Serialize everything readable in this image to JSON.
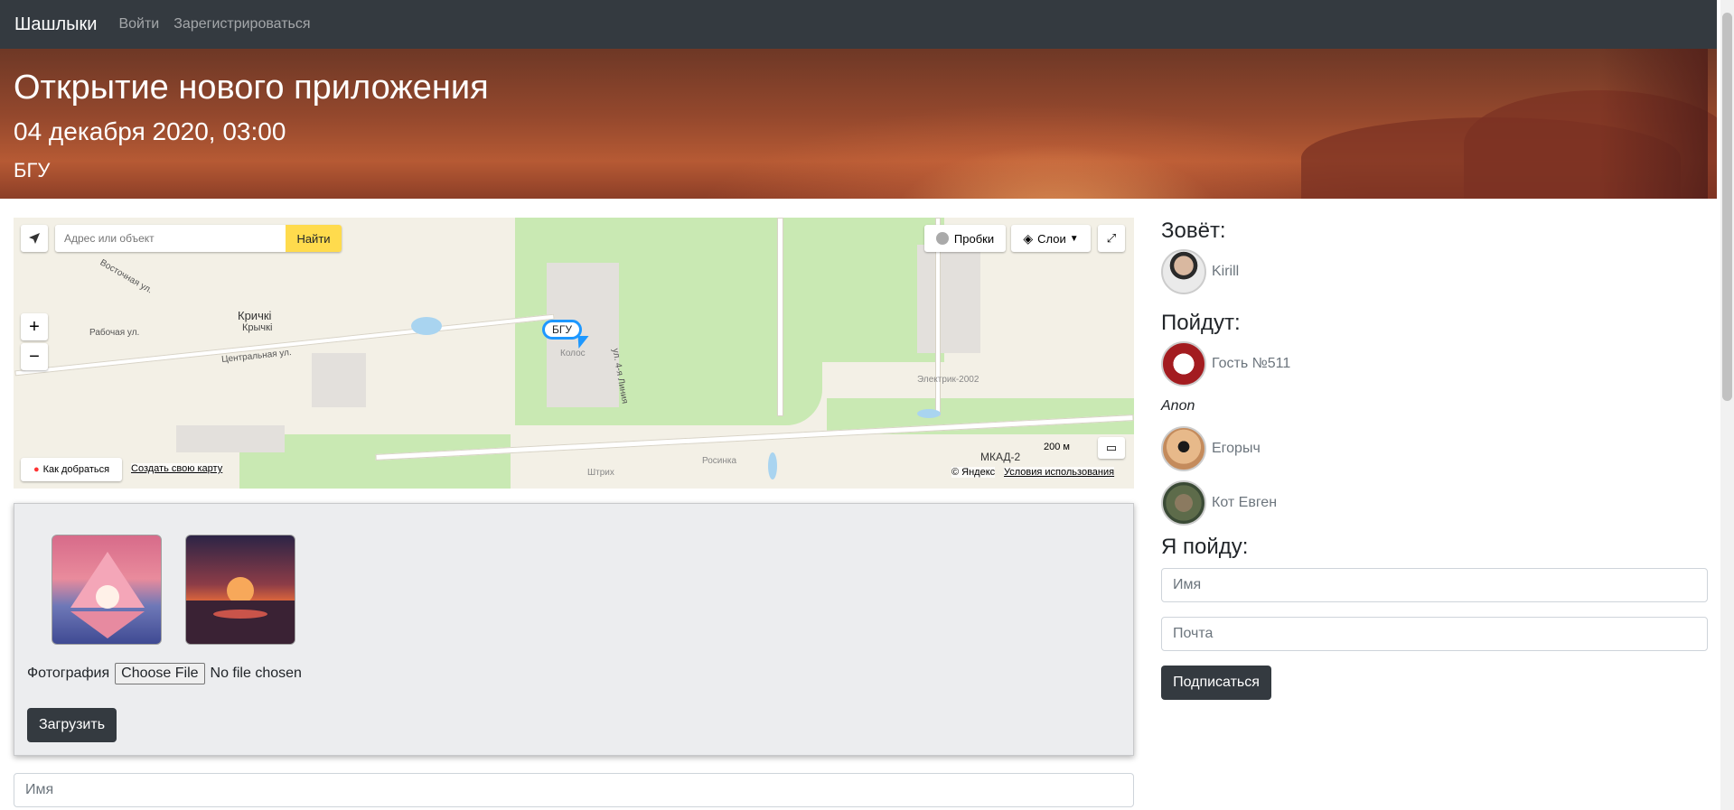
{
  "navbar": {
    "brand": "Шашлыки",
    "links": [
      "Войти",
      "Зарегистрироваться"
    ]
  },
  "hero": {
    "title": "Открытие нового приложения",
    "date": "04 декабря 2020, 03:00",
    "place": "БГУ"
  },
  "map": {
    "search_placeholder": "Адрес или объект",
    "search_button": "Найти",
    "traffic": "Пробки",
    "layers": "Слои",
    "marker": "БГУ",
    "labels": [
      "Кричкі",
      "Крычкі",
      "Рабочая ул.",
      "Восточная ул.",
      "Центральная ул.",
      "Колос",
      "ул. 4-я Линия",
      "Электрик-2002",
      "Штрих",
      "Росинка",
      "МКАД-2"
    ],
    "scale": "200 м",
    "route": "Как добраться",
    "create_map": "Создать свою карту",
    "copyright": "© Яндекс",
    "terms": "Условия использования"
  },
  "gallery": {
    "file_label": "Фотография",
    "file_button": "Choose File",
    "file_status": "No file chosen",
    "upload_button": "Загрузить"
  },
  "comment": {
    "name_placeholder": "Имя"
  },
  "sidebar": {
    "inviter_heading": "Зовёт:",
    "inviter": "Kirill",
    "going_heading": "Пойдут:",
    "guests": [
      "Гость №511",
      "Anon",
      "Егорыч",
      "Кот Евген"
    ],
    "join_heading": "Я пойду:",
    "name_placeholder": "Имя",
    "email_placeholder": "Почта",
    "subscribe_button": "Подписаться"
  },
  "colors": {
    "navbar": "#343a40",
    "button": "#343a40",
    "map_search_button": "#ffdb4d",
    "marker": "#1e98ff"
  }
}
